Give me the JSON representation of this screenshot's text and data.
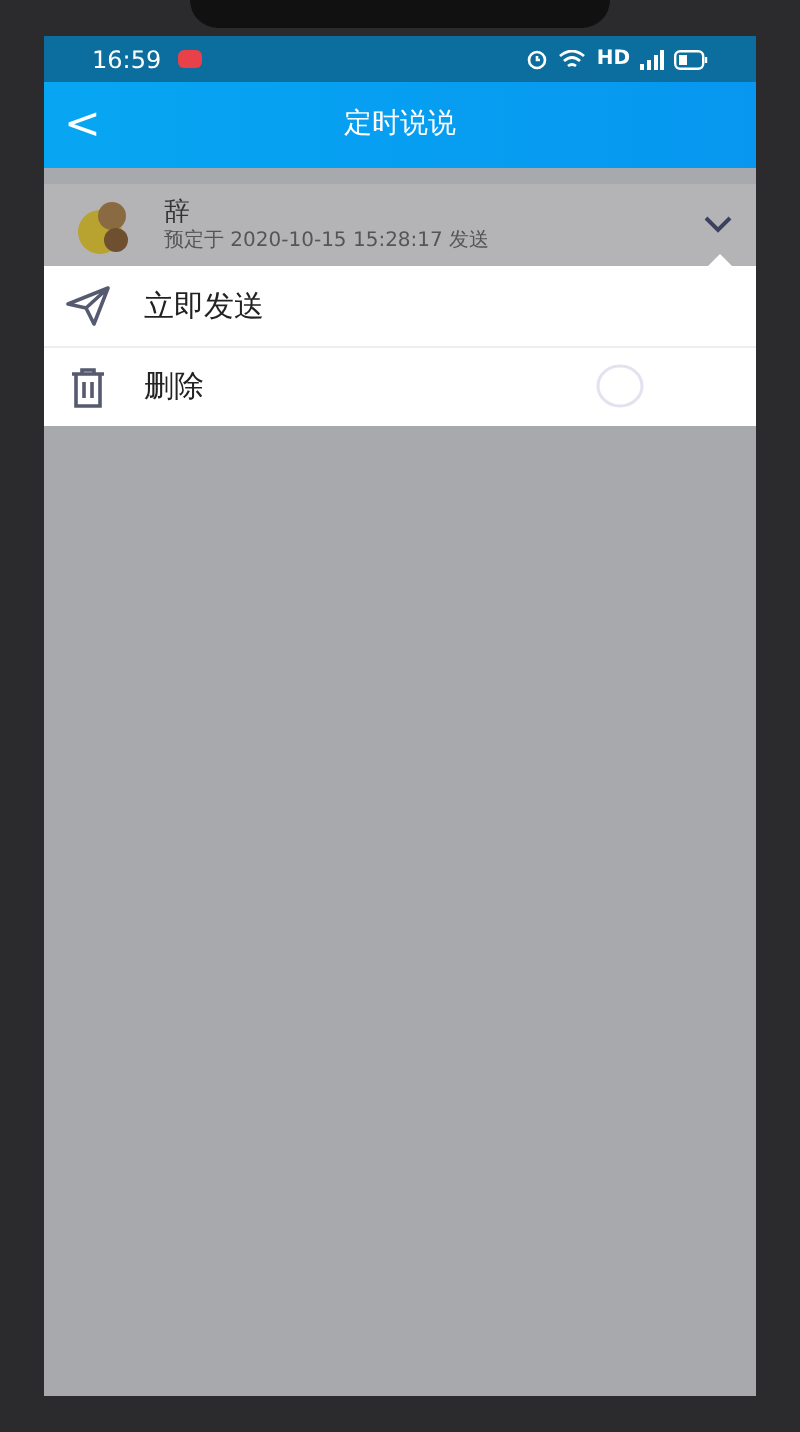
{
  "status_bar": {
    "time": "16:59",
    "network": "HD"
  },
  "header": {
    "back": "<",
    "title": "定时说说"
  },
  "post": {
    "name": "辞",
    "schedule": "预定于 2020-10-15 15:28:17 发送"
  },
  "menu": [
    {
      "kind": "send",
      "label": "立即发送"
    },
    {
      "kind": "delete",
      "label": "删除"
    }
  ]
}
